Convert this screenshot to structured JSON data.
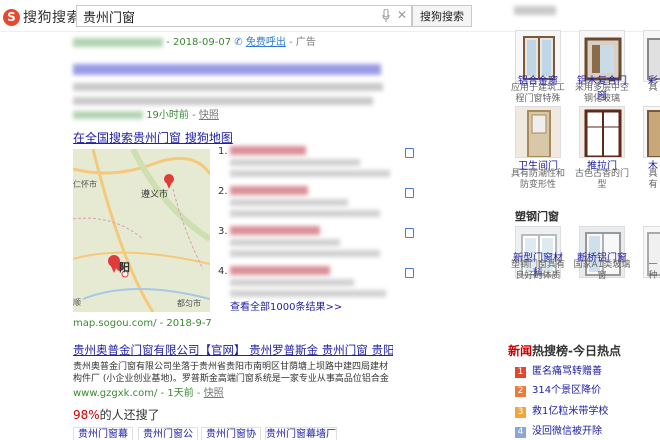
{
  "header": {
    "logo_text": "搜狗搜索",
    "logo_mark": "S",
    "query": "贵州门窗",
    "search_button": "搜狗搜索"
  },
  "result1": {
    "url_tail": "- 2018-09-07",
    "phone_label": "免费呼出",
    "ad_label": "- 广告"
  },
  "result2": {
    "time": "19小时前",
    "snapshot": "快照"
  },
  "map_block": {
    "title": "在全国搜索贵州门窗 搜狗地图",
    "city_label": "遵义市",
    "city_short": "阳",
    "more_link": "查看全部1000条结果>>",
    "source": "map.sogou.com/ - 2018-9-7",
    "poi_numbers": [
      "1.",
      "2.",
      "3.",
      "4."
    ],
    "map_labels": [
      "仁怀市",
      "都匀市",
      "顺"
    ]
  },
  "result3": {
    "title": "贵州奥普金门窗有限公司【官网】 贵州罗普斯金 贵州门窗 贵阳门窗贵...",
    "snippet": "贵州奥普金门窗有限公司坐落于贵州省贵阳市南明区甘荫塘上坝路中建四局建材构件厂 (小企业创业基地)。罗普斯金高端门窗系统是一家专业从事高品位铝合金门窗的高端品牌...",
    "url": "www.gzgxk.com/",
    "time": "- 1天前",
    "snapshot": "快照"
  },
  "related": {
    "prefix": "98%",
    "title_suffix": "的人还搜了",
    "items": [
      "贵州门窗幕墙",
      "贵州门窗公司",
      "贵州门窗协会",
      "贵州门窗幕墙厂家"
    ]
  },
  "sidebar": {
    "section1_items": [
      {
        "label": "铝合金窗",
        "sub": "应用于建筑工程门窗特殊"
      },
      {
        "label": "铝木复合门窗",
        "sub": "采用多层中空钢化玻璃"
      },
      {
        "label": "彩",
        "sub": "具"
      }
    ],
    "section2_items": [
      {
        "label": "卫生间门",
        "sub": "具有防潮性和防变形性"
      },
      {
        "label": "推拉门",
        "sub": "古色古香的门型"
      },
      {
        "label": "木",
        "sub": "具有"
      }
    ],
    "section3_title": "塑钢门窗",
    "section3_items": [
      {
        "label": "新型门窗材料",
        "sub": "塑钢门窗具有良好的体质"
      },
      {
        "label": "断桥铝门窗",
        "sub": "国家A1类玻璃窗"
      },
      {
        "label": "",
        "sub": "一种"
      }
    ],
    "hot_title_brand": "新闻",
    "hot_title_rest": "热搜榜-今日热点",
    "hot_items": [
      {
        "num": "1",
        "text": "匿名痛骂转赠善"
      },
      {
        "num": "2",
        "text": "314个景区降价"
      },
      {
        "num": "3",
        "text": "救1亿粒米带学校"
      },
      {
        "num": "4",
        "text": "没回微信被开除"
      }
    ],
    "colors": {
      "hot1": "#e4472c",
      "hot2": "#f07a3c",
      "hot3": "#f3a43a",
      "hot4": "#8aa7d6"
    }
  }
}
